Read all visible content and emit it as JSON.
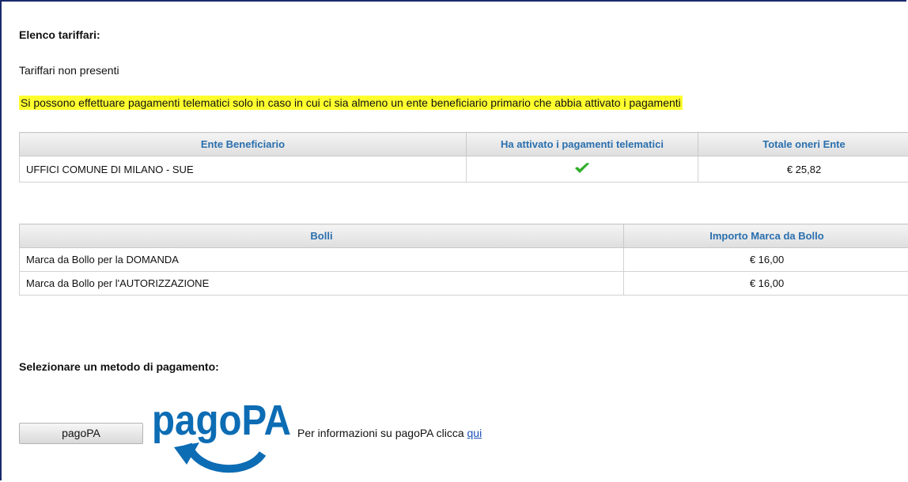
{
  "header": {
    "title": "Elenco tariffari:",
    "no_results": "Tariffari non presenti",
    "notice": "Si possono effettuare pagamenti telematici solo in caso in cui ci sia almeno un ente beneficiario primario che abbia attivato i pagamenti"
  },
  "enti_table": {
    "columns": [
      "Ente Beneficiario",
      "Ha attivato i pagamenti telematici",
      "Totale oneri Ente"
    ],
    "rows": [
      {
        "ente": "UFFICI COMUNE DI MILANO - SUE",
        "attivato_icon": "checkmark-icon",
        "totale": "€ 25,82"
      }
    ]
  },
  "bolli_table": {
    "columns": [
      "Bolli",
      "Importo Marca da Bollo"
    ],
    "rows": [
      {
        "bollo": "Marca da Bollo per la DOMANDA",
        "importo": "€ 16,00"
      },
      {
        "bollo": "Marca da Bollo per l'AUTORIZZAZIONE",
        "importo": "€ 16,00"
      }
    ]
  },
  "payment": {
    "label": "Selezionare un metodo di pagamento:",
    "button_label": "pagoPA",
    "logo_text": "pagoPA",
    "info_text": "Per informazioni su pagoPA clicca ",
    "info_link": "qui"
  },
  "colors": {
    "header_text": "#2a6fae",
    "notice_bg": "#ffff2e",
    "logo_blue": "#0c6cb4",
    "check_green": "#2fae2b"
  }
}
